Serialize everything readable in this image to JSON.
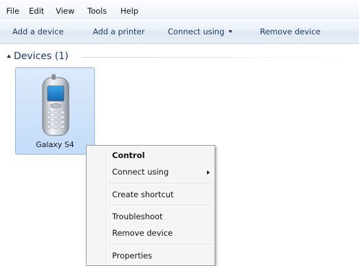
{
  "menubar": {
    "items": [
      {
        "label": "File"
      },
      {
        "label": "Edit"
      },
      {
        "label": "View"
      },
      {
        "label": "Tools"
      },
      {
        "label": "Help"
      }
    ]
  },
  "toolbar": {
    "add_device": "Add a device",
    "add_printer": "Add a printer",
    "connect_using": "Connect using",
    "remove_device": "Remove device"
  },
  "group": {
    "header": "Devices (1)",
    "devices": [
      {
        "label": "Galaxy S4",
        "icon": "mobile-phone-icon"
      }
    ]
  },
  "context_menu": {
    "items": [
      {
        "label": "Control",
        "bold": true
      },
      {
        "label": "Connect using",
        "submenu": true
      },
      {
        "label": "Create shortcut"
      },
      {
        "label": "Troubleshoot"
      },
      {
        "label": "Remove device"
      },
      {
        "label": "Properties"
      }
    ]
  },
  "colors": {
    "toolbar_text": "#1e395b",
    "group_header_text": "#1e3287",
    "selection_fill": "#c3dcf8",
    "selection_border": "#8fb4e0"
  }
}
